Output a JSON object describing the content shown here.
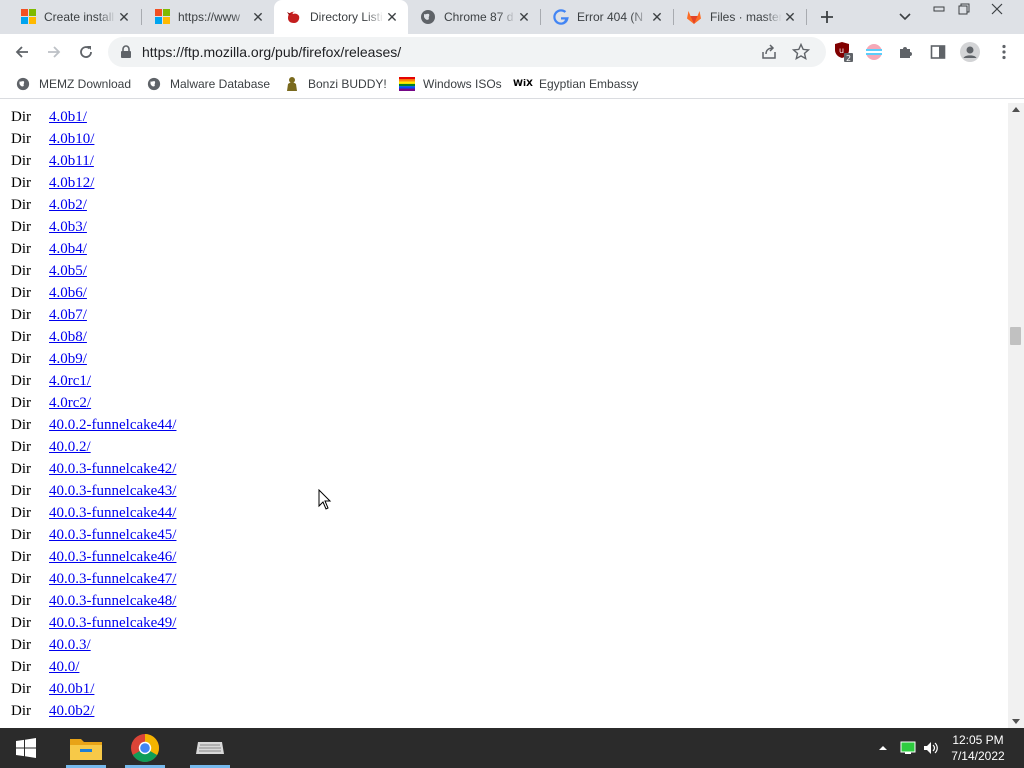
{
  "browser": {
    "tabs": [
      {
        "title": "Create install",
        "favicon": "microsoft-logo",
        "active": false
      },
      {
        "title": "https://www",
        "favicon": "microsoft-logo",
        "active": false
      },
      {
        "title": "Directory Listi",
        "favicon": "firefox-logo",
        "active": true
      },
      {
        "title": "Chrome 87 d",
        "favicon": "globe-icon",
        "active": false
      },
      {
        "title": "Error 404 (N",
        "favicon": "google-logo",
        "active": false
      },
      {
        "title": "Files · master",
        "favicon": "gitlab-logo",
        "active": false
      }
    ],
    "url": "https://ftp.mozilla.org/pub/firefox/releases/",
    "extension_badge": "2"
  },
  "bookmarks": [
    {
      "label": "MEMZ Download",
      "icon": "globe-icon"
    },
    {
      "label": "Malware Database",
      "icon": "globe-icon"
    },
    {
      "label": "Bonzi BUDDY!",
      "icon": "bonzi-icon"
    },
    {
      "label": "Windows ISOs",
      "icon": "rainbow-flag-icon"
    },
    {
      "label": "Egyptian Embassy",
      "icon": "wix-icon"
    }
  ],
  "listing": {
    "rows": [
      {
        "type": "Dir",
        "name": "4.0b1/"
      },
      {
        "type": "Dir",
        "name": "4.0b10/"
      },
      {
        "type": "Dir",
        "name": "4.0b11/"
      },
      {
        "type": "Dir",
        "name": "4.0b12/"
      },
      {
        "type": "Dir",
        "name": "4.0b2/"
      },
      {
        "type": "Dir",
        "name": "4.0b3/"
      },
      {
        "type": "Dir",
        "name": "4.0b4/"
      },
      {
        "type": "Dir",
        "name": "4.0b5/"
      },
      {
        "type": "Dir",
        "name": "4.0b6/"
      },
      {
        "type": "Dir",
        "name": "4.0b7/"
      },
      {
        "type": "Dir",
        "name": "4.0b8/"
      },
      {
        "type": "Dir",
        "name": "4.0b9/"
      },
      {
        "type": "Dir",
        "name": "4.0rc1/"
      },
      {
        "type": "Dir",
        "name": "4.0rc2/"
      },
      {
        "type": "Dir",
        "name": "40.0.2-funnelcake44/"
      },
      {
        "type": "Dir",
        "name": "40.0.2/"
      },
      {
        "type": "Dir",
        "name": "40.0.3-funnelcake42/"
      },
      {
        "type": "Dir",
        "name": "40.0.3-funnelcake43/"
      },
      {
        "type": "Dir",
        "name": "40.0.3-funnelcake44/"
      },
      {
        "type": "Dir",
        "name": "40.0.3-funnelcake45/"
      },
      {
        "type": "Dir",
        "name": "40.0.3-funnelcake46/"
      },
      {
        "type": "Dir",
        "name": "40.0.3-funnelcake47/"
      },
      {
        "type": "Dir",
        "name": "40.0.3-funnelcake48/"
      },
      {
        "type": "Dir",
        "name": "40.0.3-funnelcake49/"
      },
      {
        "type": "Dir",
        "name": "40.0.3/"
      },
      {
        "type": "Dir",
        "name": "40.0/"
      },
      {
        "type": "Dir",
        "name": "40.0b1/"
      },
      {
        "type": "Dir",
        "name": "40.0b2/"
      }
    ]
  },
  "taskbar": {
    "apps": [
      "file-explorer-icon",
      "chrome-icon",
      "keyboard-app-icon"
    ],
    "clock": {
      "time": "12:05 PM",
      "date": "7/14/2022"
    }
  },
  "colors": {
    "tabstrip": "#dee1e6",
    "link": "#0000ee",
    "taskbar": "#2b2b2b",
    "active_indicator": "#76b9ed"
  }
}
